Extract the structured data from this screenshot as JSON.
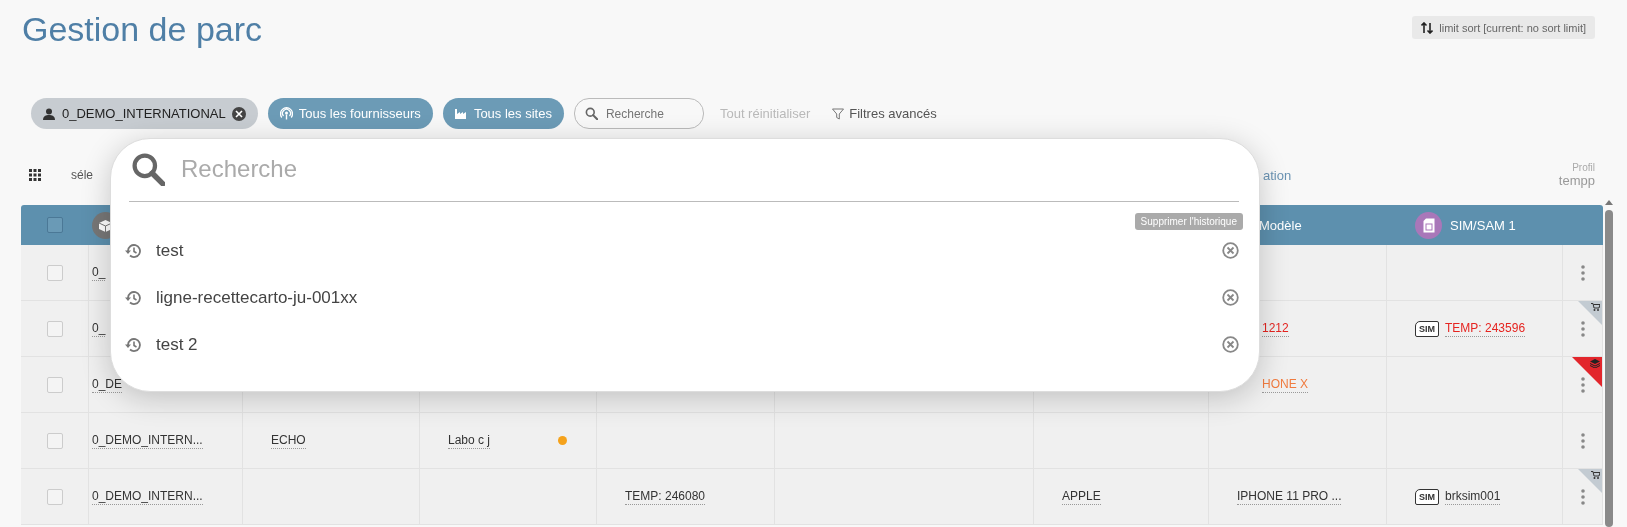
{
  "page": {
    "title": "Gestion de parc",
    "sort_button": "limit sort [current: no sort limit]"
  },
  "filters": [
    {
      "kind": "account",
      "label": "0_DEMO_INTERNATIONAL"
    },
    {
      "kind": "suppliers",
      "label": "Tous les fournisseurs"
    },
    {
      "kind": "sites",
      "label": "Tous les sites"
    },
    {
      "kind": "search",
      "placeholder": "Recherche"
    },
    {
      "kind": "reset",
      "label": "Tout réinitialiser",
      "disabled": true
    },
    {
      "kind": "advanced",
      "label": "Filtres avancés"
    }
  ],
  "toolbar": {
    "selection_fragment": "séle",
    "action_fragment": "ation",
    "profile_label": "Profil",
    "profile_value": "tempp"
  },
  "table": {
    "columns": [
      {
        "kind": "checkbox",
        "checked": false
      },
      {
        "kind": "icon"
      },
      {
        "kind": "hidden"
      },
      {
        "kind": "hidden"
      },
      {
        "kind": "hidden"
      },
      {
        "kind": "hidden"
      },
      {
        "kind": "hidden"
      },
      {
        "kind": "text",
        "label": "Modèle"
      },
      {
        "kind": "sim",
        "label": "SIM/SAM 1"
      }
    ],
    "rows": [
      {
        "checked": false,
        "column_1": {
          "text": "0_"
        }
      },
      {
        "checked": false,
        "column_1": {
          "text": "0_"
        },
        "column_7": {
          "text": "1212",
          "color": "#e52420",
          "covered": true
        },
        "column_8": {
          "text": "TEMP: 243596",
          "color": "#e52420",
          "sim_badge": "SIM"
        },
        "flag": {
          "kind": "cart"
        }
      },
      {
        "checked": false,
        "column_1": {
          "text": "0_DE"
        },
        "column_7": {
          "text": "HONE X",
          "color": "#f07b3f",
          "covered": true
        },
        "flag": {
          "kind": "layers"
        }
      },
      {
        "checked": false,
        "column_1": {
          "text": "0_DEMO_INTERN..."
        },
        "column_2": {
          "text": "ECHO"
        },
        "column_3": {
          "text": "Labo c j",
          "dot": {
            "color": "#f5a21b"
          }
        }
      },
      {
        "checked": false,
        "column_1": {
          "text": "0_DEMO_INTERN..."
        },
        "column_4": {
          "text": "TEMP: 246080"
        },
        "column_6": {
          "text": "APPLE"
        },
        "column_7": {
          "text": "IPHONE 11 PRO ..."
        },
        "column_8": {
          "text": "brksim001",
          "sim_badge": "SIM"
        },
        "flag": {
          "kind": "cart"
        }
      }
    ]
  },
  "search_popup": {
    "placeholder": "Recherche",
    "clear_history": "Supprimer l'historique",
    "history": [
      {
        "text": "test"
      },
      {
        "text": "ligne-recettecarto-ju-001xx"
      },
      {
        "text": "test 2"
      }
    ]
  }
}
